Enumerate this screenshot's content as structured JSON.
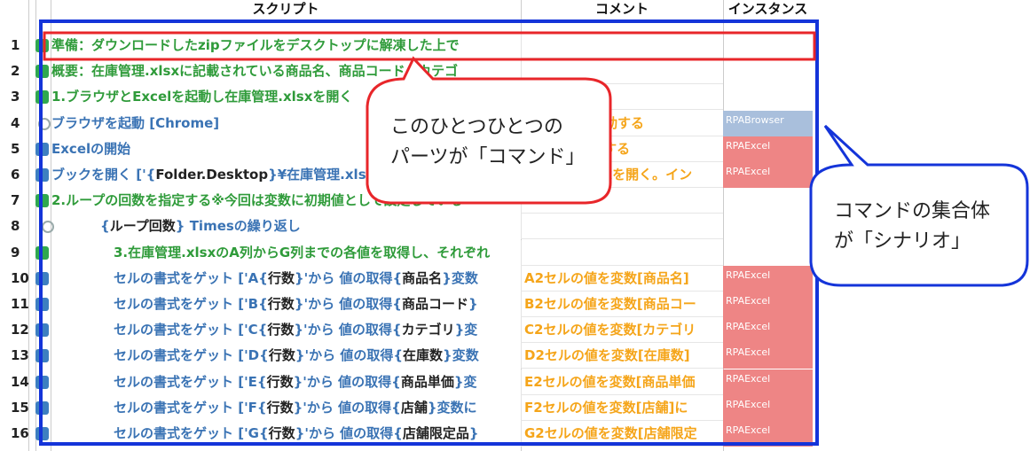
{
  "header": {
    "script_col": "スクリプト",
    "comment_col": "コメント",
    "instance_col": "インスタンス"
  },
  "rows": [
    {
      "num": "1",
      "icon": "green",
      "indent": 0,
      "color": "c-green",
      "parts": [
        {
          "t": "準備：ダウンロードしたzipファイルをデスクトップに解凍した上で",
          "c": ""
        }
      ],
      "comment": "",
      "inst": "",
      "inst_type": ""
    },
    {
      "num": "2",
      "icon": "green",
      "indent": 0,
      "color": "c-green",
      "parts": [
        {
          "t": "概要：在庫管理.xlsxに記載されている商品名、商品コード、カテゴ",
          "c": ""
        }
      ],
      "comment": "",
      "inst": "",
      "inst_type": ""
    },
    {
      "num": "3",
      "icon": "green",
      "indent": 0,
      "color": "c-green",
      "parts": [
        {
          "t": "1.ブラウザとExcelを起動し在庫管理.xlsxを開く",
          "c": ""
        }
      ],
      "comment": "",
      "inst": "",
      "inst_type": ""
    },
    {
      "num": "4",
      "icon": "grey",
      "indent": 0,
      "color": "c-blue",
      "parts": [
        {
          "t": "ブラウザを起動 [Chrome]",
          "c": ""
        }
      ],
      "comment": "ブラウザを起動する",
      "inst": "RPABrowser",
      "inst_type": "blue"
    },
    {
      "num": "5",
      "icon": "blue",
      "indent": 0,
      "color": "c-blue",
      "parts": [
        {
          "t": "Excelの開始",
          "c": ""
        }
      ],
      "comment": "Excelを開始する",
      "inst": "RPAExcel",
      "inst_type": "red"
    },
    {
      "num": "6",
      "icon": "blue",
      "indent": 0,
      "color": "c-blue",
      "parts": [
        {
          "t": "ブックを開く ['{",
          "c": ""
        },
        {
          "t": "Folder.Desktop",
          "c": "c-dark"
        },
        {
          "t": "}¥在庫管理.xlsx']",
          "c": ""
        }
      ],
      "comment": "在庫管理.xlsxを開く。イン",
      "inst": "RPAExcel",
      "inst_type": "red"
    },
    {
      "num": "7",
      "icon": "green",
      "indent": 0,
      "color": "c-green",
      "parts": [
        {
          "t": "2.ループの回数を指定する※今回は変数に初期値として設定している",
          "c": ""
        }
      ],
      "comment": "",
      "inst": "",
      "inst_type": ""
    },
    {
      "num": "8",
      "icon": "grey",
      "indent": 1,
      "color": "c-blue",
      "parts": [
        {
          "t": "{",
          "c": ""
        },
        {
          "t": "ループ回数",
          "c": "c-dark"
        },
        {
          "t": "} Timesの繰り返し",
          "c": ""
        }
      ],
      "comment": "",
      "inst": "",
      "inst_type": ""
    },
    {
      "num": "9",
      "icon": "green",
      "indent": 2,
      "color": "c-green",
      "parts": [
        {
          "t": "3.在庫管理.xlsxのA列からG列までの各値を取得し、それぞれ",
          "c": ""
        }
      ],
      "comment": "",
      "inst": "",
      "inst_type": ""
    },
    {
      "num": "10",
      "icon": "blue",
      "indent": 2,
      "color": "c-blue",
      "parts": [
        {
          "t": "セルの書式をゲット ['A{",
          "c": ""
        },
        {
          "t": "行数",
          "c": "c-dark"
        },
        {
          "t": "}'から 値の取得{",
          "c": ""
        },
        {
          "t": "商品名",
          "c": "c-dark"
        },
        {
          "t": "}変数",
          "c": ""
        }
      ],
      "comment": "A2セルの値を変数[商品名]",
      "inst": "RPAExcel",
      "inst_type": "red"
    },
    {
      "num": "11",
      "icon": "blue",
      "indent": 2,
      "color": "c-blue",
      "parts": [
        {
          "t": "セルの書式をゲット ['B{",
          "c": ""
        },
        {
          "t": "行数",
          "c": "c-dark"
        },
        {
          "t": "}'から 値の取得{",
          "c": ""
        },
        {
          "t": "商品コード",
          "c": "c-dark"
        },
        {
          "t": "}",
          "c": ""
        }
      ],
      "comment": "B2セルの値を変数[商品コー",
      "inst": "RPAExcel",
      "inst_type": "red"
    },
    {
      "num": "12",
      "icon": "blue",
      "indent": 2,
      "color": "c-blue",
      "parts": [
        {
          "t": "セルの書式をゲット ['C{",
          "c": ""
        },
        {
          "t": "行数",
          "c": "c-dark"
        },
        {
          "t": "}'から 値の取得{",
          "c": ""
        },
        {
          "t": "カテゴリ",
          "c": "c-dark"
        },
        {
          "t": "}変",
          "c": ""
        }
      ],
      "comment": "C2セルの値を変数[カテゴリ",
      "inst": "RPAExcel",
      "inst_type": "red"
    },
    {
      "num": "13",
      "icon": "blue",
      "indent": 2,
      "color": "c-blue",
      "parts": [
        {
          "t": "セルの書式をゲット ['D{",
          "c": ""
        },
        {
          "t": "行数",
          "c": "c-dark"
        },
        {
          "t": "}'から 値の取得{",
          "c": ""
        },
        {
          "t": "在庫数",
          "c": "c-dark"
        },
        {
          "t": "}変数",
          "c": ""
        }
      ],
      "comment": "D2セルの値を変数[在庫数]",
      "inst": "RPAExcel",
      "inst_type": "red"
    },
    {
      "num": "14",
      "icon": "blue",
      "indent": 2,
      "color": "c-blue",
      "parts": [
        {
          "t": "セルの書式をゲット ['E{",
          "c": ""
        },
        {
          "t": "行数",
          "c": "c-dark"
        },
        {
          "t": "}'から 値の取得{",
          "c": ""
        },
        {
          "t": "商品単価",
          "c": "c-dark"
        },
        {
          "t": "}変",
          "c": ""
        }
      ],
      "comment": "E2セルの値を変数[商品単価",
      "inst": "RPAExcel",
      "inst_type": "red"
    },
    {
      "num": "15",
      "icon": "blue",
      "indent": 2,
      "color": "c-blue",
      "parts": [
        {
          "t": "セルの書式をゲット ['F{",
          "c": ""
        },
        {
          "t": "行数",
          "c": "c-dark"
        },
        {
          "t": "}'から 値の取得{",
          "c": ""
        },
        {
          "t": "店舗",
          "c": "c-dark"
        },
        {
          "t": "}変数に",
          "c": ""
        }
      ],
      "comment": "F2セルの値を変数[店舗]に",
      "inst": "RPAExcel",
      "inst_type": "red"
    },
    {
      "num": "16",
      "icon": "blue",
      "indent": 2,
      "color": "c-blue",
      "parts": [
        {
          "t": "セルの書式をゲット ['G{",
          "c": ""
        },
        {
          "t": "行数",
          "c": "c-dark"
        },
        {
          "t": "}'から 値の取得{",
          "c": ""
        },
        {
          "t": "店舗限定品",
          "c": "c-dark"
        },
        {
          "t": "}",
          "c": ""
        }
      ],
      "comment": "G2セルの値を変数[店舗限定",
      "inst": "RPAExcel",
      "inst_type": "red"
    }
  ],
  "callouts": {
    "command_line1": "このひとつひとつの",
    "command_line2": "パーツが「コマンド」",
    "scenario_line1": "コマンドの集合体",
    "scenario_line2": "が「シナリオ」"
  },
  "colors": {
    "highlight_red": "#e8262a",
    "scenario_blue": "#1434d9",
    "instance_red": "#ee8585",
    "instance_blue": "#a9bfdc"
  }
}
